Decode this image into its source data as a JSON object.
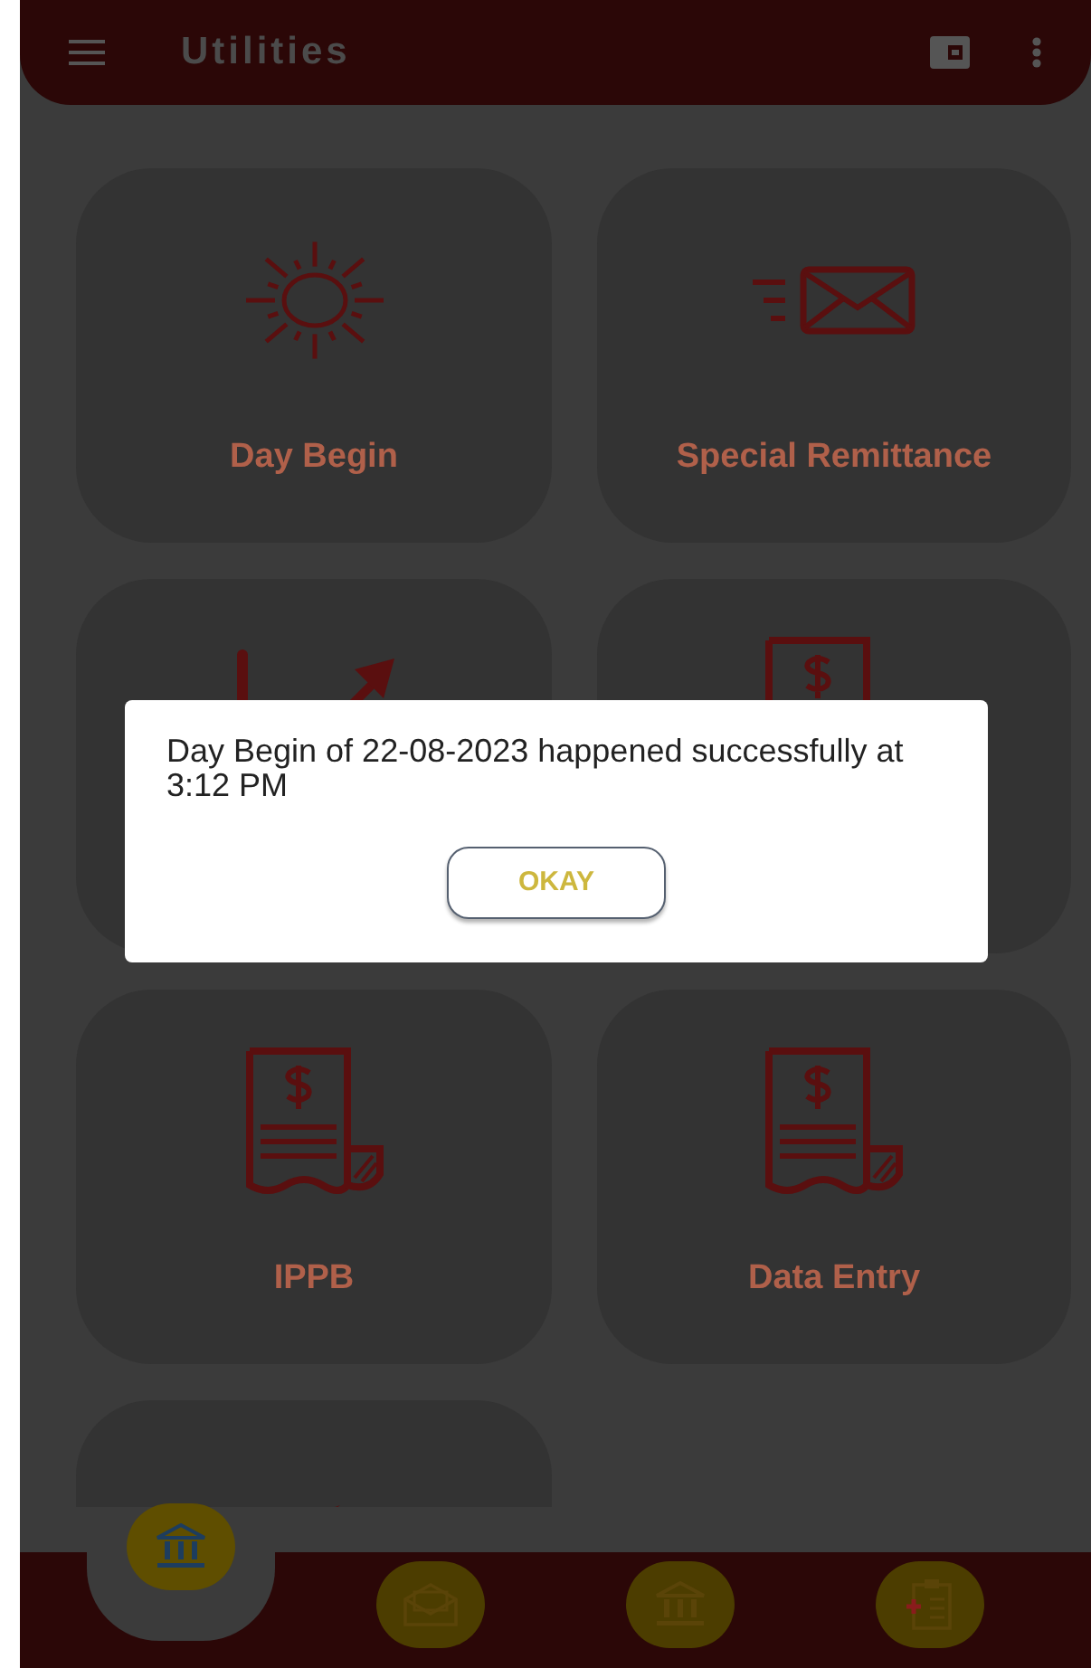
{
  "header": {
    "title": "Utilities"
  },
  "tiles": [
    {
      "kind": "labeled",
      "label": "Day Begin"
    },
    {
      "kind": "labeled",
      "label": "Special Remittance"
    },
    {
      "kind": "icon_only"
    },
    {
      "kind": "icon_only"
    },
    {
      "kind": "labeled",
      "label": "IPPB"
    },
    {
      "kind": "labeled",
      "label": "Data Entry"
    },
    {
      "kind": "icon_only"
    }
  ],
  "dialog": {
    "message": "Day Begin of 22-08-2023 happened successfully at 3:12 PM",
    "button": "OKAY"
  },
  "bottom_nav": [
    {
      "selected": true
    },
    {
      "selected": false
    },
    {
      "selected": false
    },
    {
      "selected": false
    }
  ]
}
